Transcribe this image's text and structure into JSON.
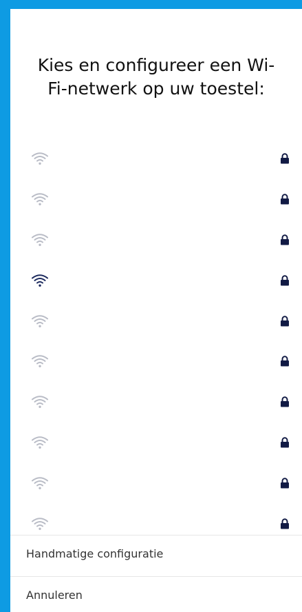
{
  "dialog": {
    "title": "Kies en configureer een Wi-Fi-netwerk op uw toestel:"
  },
  "networks": [
    {
      "signal_icon": "wifi-icon",
      "secured_icon": "lock-icon",
      "highlighted": false
    },
    {
      "signal_icon": "wifi-icon",
      "secured_icon": "lock-icon",
      "highlighted": false
    },
    {
      "signal_icon": "wifi-icon",
      "secured_icon": "lock-icon",
      "highlighted": false
    },
    {
      "signal_icon": "wifi-icon",
      "secured_icon": "lock-icon",
      "highlighted": true
    },
    {
      "signal_icon": "wifi-icon",
      "secured_icon": "lock-icon",
      "highlighted": false
    },
    {
      "signal_icon": "wifi-icon",
      "secured_icon": "lock-icon",
      "highlighted": false
    },
    {
      "signal_icon": "wifi-icon",
      "secured_icon": "lock-icon",
      "highlighted": false
    },
    {
      "signal_icon": "wifi-icon",
      "secured_icon": "lock-icon",
      "highlighted": false
    },
    {
      "signal_icon": "wifi-icon",
      "secured_icon": "lock-icon",
      "highlighted": false
    },
    {
      "signal_icon": "wifi-icon",
      "secured_icon": "lock-icon",
      "highlighted": false
    }
  ],
  "actions": {
    "manual_label": "Handmatige configuratie",
    "cancel_label": "Annuleren"
  },
  "colors": {
    "frame": "#0e9be3",
    "wifi_faded": "#b9bcc6",
    "wifi_highlight": "#1c2a5e",
    "lock": "#111a44"
  }
}
